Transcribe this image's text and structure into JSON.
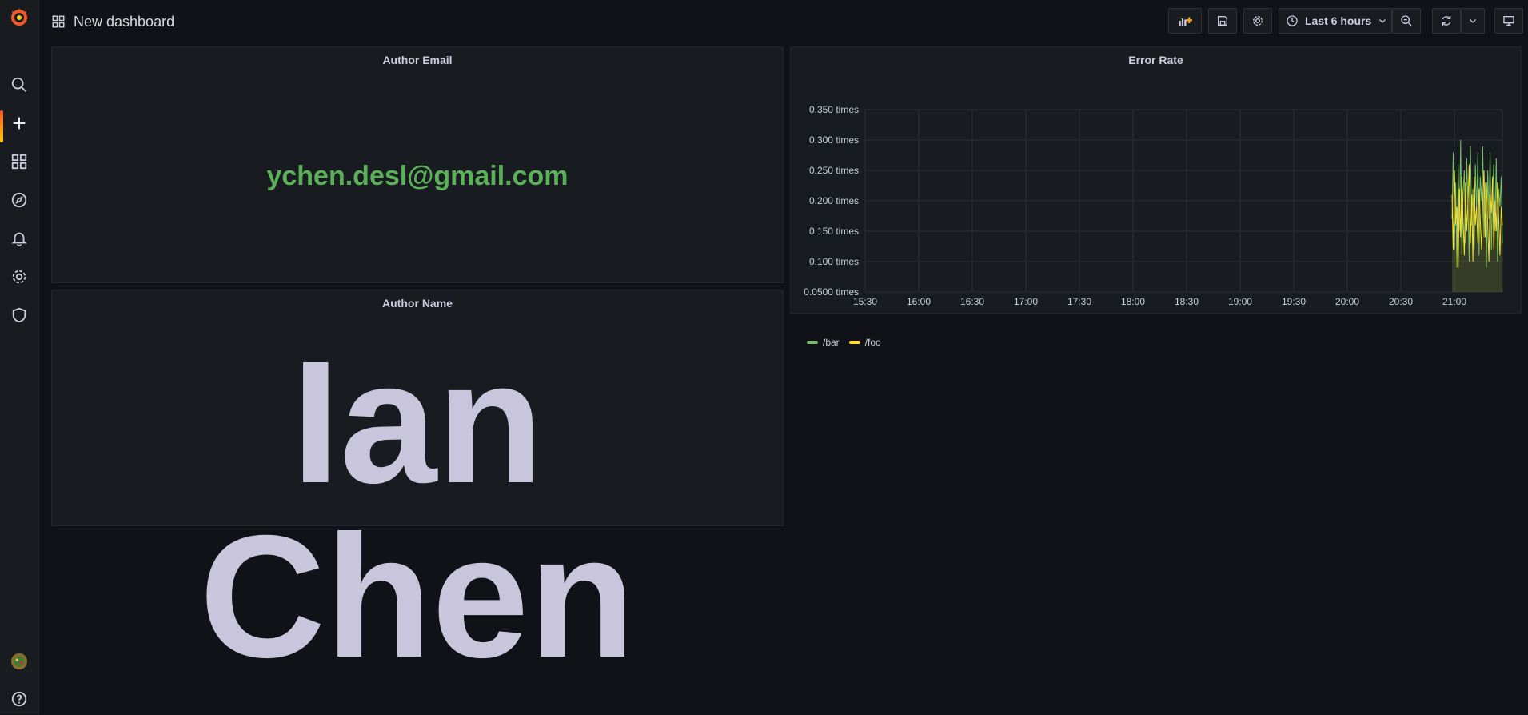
{
  "header": {
    "title": "New dashboard"
  },
  "toolbar": {
    "time_range": "Last 6 hours"
  },
  "panels": {
    "author_email": {
      "title": "Author Email",
      "value": "ychen.desl@gmail.com"
    },
    "author_name": {
      "title": "Author Name",
      "value": "Ian Chen"
    },
    "error_rate": {
      "title": "Error Rate"
    }
  },
  "sidebar": {
    "items": [
      {
        "icon": "search-icon"
      },
      {
        "icon": "plus-icon"
      },
      {
        "icon": "apps-icon"
      },
      {
        "icon": "compass-icon"
      },
      {
        "icon": "bell-icon"
      },
      {
        "icon": "gear-icon"
      },
      {
        "icon": "shield-icon"
      }
    ]
  },
  "colors": {
    "accent_green": "#5cb05a",
    "series_bar": "#73bf69",
    "series_foo": "#fade2a",
    "brand": "#f05a28"
  },
  "chart_data": {
    "type": "line",
    "title": "Error Rate",
    "x_ticks": [
      "15:30",
      "16:00",
      "16:30",
      "17:00",
      "17:30",
      "18:00",
      "18:30",
      "19:00",
      "19:30",
      "20:00",
      "20:30",
      "21:00"
    ],
    "y_ticks": [
      "0.350 times",
      "0.300 times",
      "0.250 times",
      "0.200 times",
      "0.150 times",
      "0.100 times",
      "0.0500 times"
    ],
    "ylim": [
      0.05,
      0.35
    ],
    "grid": true,
    "legend_placement": "bottom-left",
    "series": [
      {
        "name": "/bar",
        "color": "#73bf69",
        "values": [
          0.17,
          0.28,
          0.12,
          0.23,
          0.09,
          0.26,
          0.15,
          0.3,
          0.11,
          0.21,
          0.25,
          0.13,
          0.27,
          0.19,
          0.1,
          0.29,
          0.16,
          0.22,
          0.12,
          0.26,
          0.18,
          0.28,
          0.11,
          0.24,
          0.2,
          0.29,
          0.14,
          0.23,
          0.09,
          0.25,
          0.17,
          0.28,
          0.12,
          0.21,
          0.26,
          0.15,
          0.27,
          0.1,
          0.22,
          0.19,
          0.24,
          0.13
        ]
      },
      {
        "name": "/foo",
        "color": "#fade2a",
        "values": [
          0.21,
          0.12,
          0.25,
          0.16,
          0.19,
          0.09,
          0.22,
          0.14,
          0.24,
          0.17,
          0.11,
          0.23,
          0.15,
          0.2,
          0.26,
          0.13,
          0.21,
          0.1,
          0.24,
          0.16,
          0.19,
          0.13,
          0.22,
          0.17,
          0.12,
          0.2,
          0.25,
          0.14,
          0.23,
          0.16,
          0.1,
          0.21,
          0.18,
          0.24,
          0.12,
          0.2,
          0.15,
          0.23,
          0.17,
          0.11,
          0.19,
          0.16
        ]
      }
    ]
  }
}
